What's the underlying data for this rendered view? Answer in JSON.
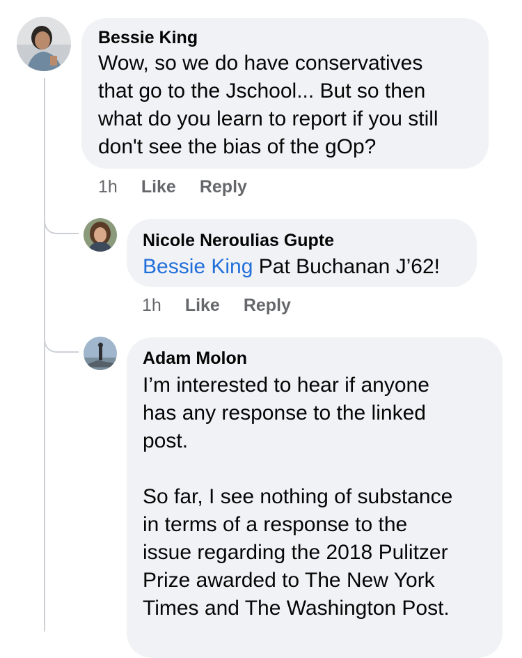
{
  "comments": [
    {
      "author": "Bessie King",
      "text": "Wow, so we do have conservatives\nthat go to the Jschool... But so then\nwhat do you learn to report if you still\ndon't see the bias of the gOp?",
      "time": "1h",
      "like_label": "Like",
      "reply_label": "Reply"
    },
    {
      "author": "Nicole Neroulias Gupte",
      "mention": "Bessie King",
      "text": " Pat Buchanan J’62!",
      "time": "1h",
      "like_label": "Like",
      "reply_label": "Reply"
    },
    {
      "author": "Adam Molon",
      "text": "I’m interested to hear if anyone\nhas any response to the linked\npost.\n\nSo far, I see nothing of substance\nin terms of a response to the\nissue regarding the 2018 Pulitzer\nPrize awarded to The New York\nTimes and The Washington Post."
    }
  ]
}
